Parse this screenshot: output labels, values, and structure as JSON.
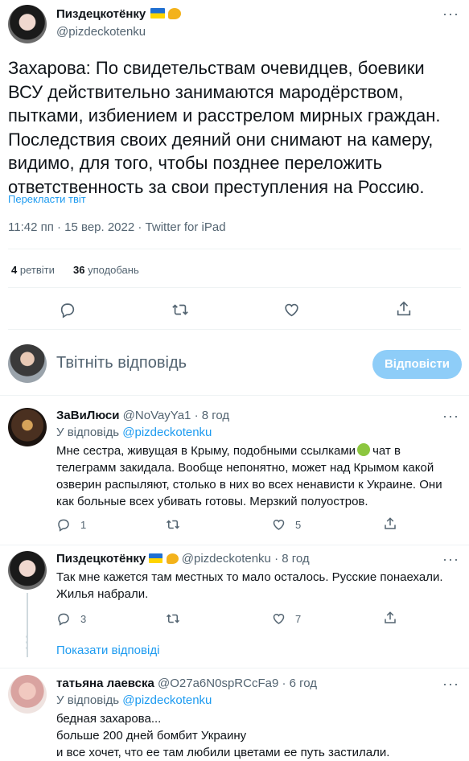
{
  "main_tweet": {
    "author_name": "Пиздецкотёнку",
    "author_handle": "@pizdeckotenku",
    "text_lines": [
      "Захарова: По свидетельствам очевидцев, боевики",
      "ВСУ действительно занимаются мародёрством,",
      "пытками, избиением и расстрелом мирных граждан.",
      "Последствия своих деяний они снимают на камеру,",
      "видимо, для того, чтобы позднее переложить",
      "ответственность за свои преступления на Россию."
    ],
    "translate_label": "Перекласти твіт",
    "timestamp": "11:42 пп · 15 вер. 2022 · Twitter for iPad",
    "retweets_count": "4",
    "retweets_label": "ретвіти",
    "likes_count": "36",
    "likes_label": "уподобань"
  },
  "compose": {
    "placeholder": "Твітніть відповідь",
    "reply_button": "Відповісти"
  },
  "replies": [
    {
      "name": "ЗаВиЛюси",
      "handle": "@NoVayYa1",
      "time": "· 8 год",
      "replying_prefix": "У відповідь",
      "replying_to": "@pizdeckotenku",
      "text_lines": [
        "Мне сестра, живущая в Крыму, подобными ссылками",
        "чат в",
        "телеграмм закидала. Вообще непонятно, может над Крымом какой",
        "озверин распыляют, столько в них во всех ненависти к Украине. Они",
        "как больные всех убивать готовы. Мерзкий полуостров."
      ],
      "reply_count": "1",
      "like_count": "5"
    },
    {
      "name": "Пиздецкотёнку",
      "handle": "@pizdeckotenku",
      "time": "· 8 год",
      "text_lines": [
        "Так мне кажется там местных то мало осталось. Русские понаехали.",
        "Жилья набрали."
      ],
      "reply_count": "3",
      "like_count": "7"
    },
    {
      "name": "татьяна лаевска",
      "handle": "@O27a6N0spRCcFa9",
      "time": "· 6 год",
      "replying_prefix": "У відповідь",
      "replying_to": "@pizdeckotenku",
      "text_lines": [
        "бедная захарова...",
        "больше 200 дней бомбит Украину",
        "и все хочет, что ее там любили  цветами ее путь застилали."
      ]
    }
  ],
  "show_replies_label": "Показати відповіді",
  "colors": {
    "accent": "#1d9bf0",
    "muted": "#536471",
    "button_disabled": "#8ecdf8"
  },
  "icons": [
    "reply-icon",
    "retweet-icon",
    "like-icon",
    "share-icon",
    "more-icon",
    "ukraine-flag-icon",
    "flexed-biceps-icon",
    "sick-face-emoji"
  ]
}
